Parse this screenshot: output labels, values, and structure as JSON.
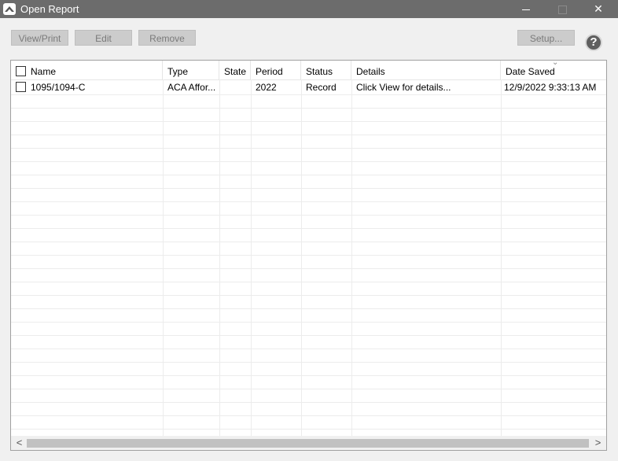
{
  "window": {
    "title": "Open Report",
    "icon": "app-logo-icon"
  },
  "toolbar": {
    "view_print": "View/Print",
    "edit": "Edit",
    "remove": "Remove",
    "setup": "Setup...",
    "help": "?"
  },
  "columns": [
    "Name",
    "Type",
    "State",
    "Period",
    "Status",
    "Details",
    "Date Saved"
  ],
  "sort": {
    "column": "Date Saved",
    "direction": "descending"
  },
  "rows": [
    {
      "checked": false,
      "name": "1095/1094-C",
      "type": "ACA Affor...",
      "state": "",
      "period": "2022",
      "status": "Record",
      "details": "Click View for details...",
      "date_saved": "12/9/2022 9:33:13 AM"
    }
  ],
  "scrollbar": {
    "left_arrow": "<",
    "right_arrow": ">"
  }
}
